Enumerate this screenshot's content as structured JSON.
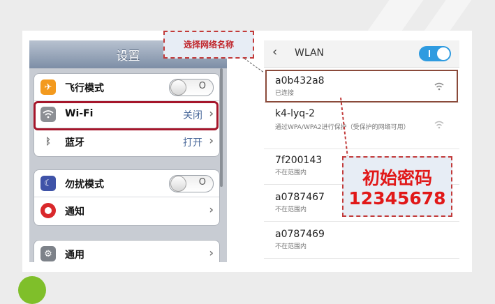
{
  "callouts": {
    "select_network": "选择网络名称",
    "initial_password_label": "初始密码",
    "initial_password_value": "12345678"
  },
  "ios_settings": {
    "title": "设置",
    "rows": [
      {
        "label": "飞行模式",
        "toggle_text": "O",
        "icon": "airplane-icon",
        "color": "#f39a1e"
      },
      {
        "label": "Wi-Fi",
        "value": "关闭",
        "icon": "wifi-icon",
        "color": "#8c8f94"
      },
      {
        "label": "蓝牙",
        "value": "打开",
        "icon": "bluetooth-icon",
        "color": "#8c8f94"
      },
      {
        "label": "勿扰模式",
        "toggle_text": "O",
        "icon": "moon-icon",
        "color": "#3f53a8"
      },
      {
        "label": "通知",
        "icon": "notification-icon",
        "color": "#d9282b"
      },
      {
        "label": "通用",
        "icon": "gear-icon",
        "color": "#7d8289"
      }
    ]
  },
  "android_wlan": {
    "title": "WLAN",
    "switch_on": true,
    "networks": [
      {
        "name": "a0b432a8",
        "status": "已连接"
      },
      {
        "name": "k4-lyq-2",
        "status": "通过WPA/WPA2进行保护（受保护的网络可用）"
      },
      {
        "name": "7f200143",
        "status": "不在范围内"
      },
      {
        "name": "a0787467",
        "status": "不在范围内"
      },
      {
        "name": "a0787469",
        "status": "不在范围内"
      }
    ]
  }
}
